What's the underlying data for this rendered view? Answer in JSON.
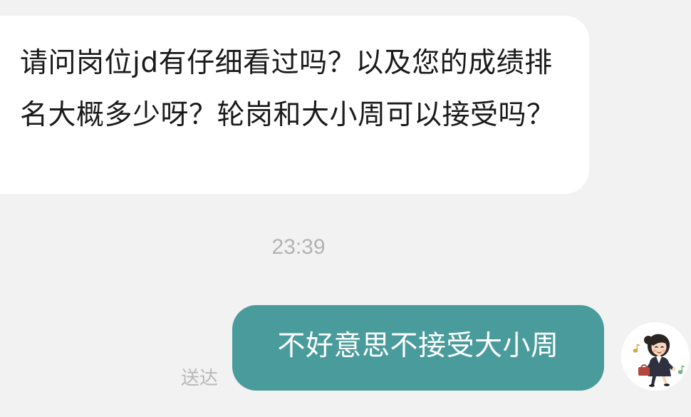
{
  "conversation": {
    "incoming_message": "请问岗位jd有仔细看过吗？以及您的成绩排名大概多少呀？轮岗和大小周可以接受吗？",
    "timestamp": "23:39",
    "outgoing_message": "不好意思不接受大小周",
    "read_status": "送达"
  },
  "user": {
    "avatar_icon": "cartoon-businesswoman-avatar"
  },
  "colors": {
    "background": "#f2f2f2",
    "incoming_bubble": "#ffffff",
    "outgoing_bubble": "#4a9c9c",
    "timestamp_text": "#b3b3b3"
  }
}
